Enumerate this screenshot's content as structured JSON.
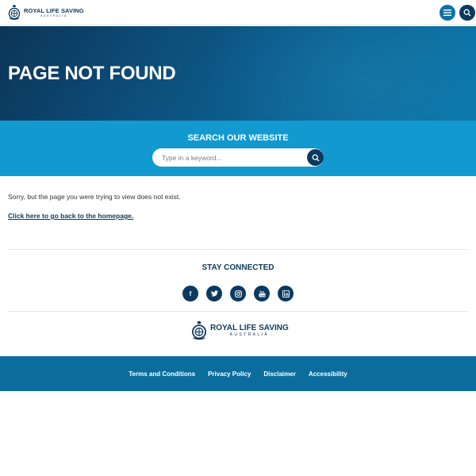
{
  "header": {
    "logo_main": "ROYAL LIFE SAVING",
    "logo_sub": "AUSTRALIA",
    "menu_icon": "hamburger-menu-icon",
    "search_icon": "search-icon"
  },
  "hero": {
    "title": "PAGE NOT FOUND"
  },
  "search": {
    "title": "SEARCH OUR WEBSITE",
    "placeholder": "Type in a keyword..."
  },
  "content": {
    "message": "Sorry, but the page you were trying to view does not exist.",
    "home_link": "Click here to go back to the homepage."
  },
  "social": {
    "title": "STAY CONNECTED",
    "items": [
      {
        "name": "facebook-icon",
        "glyph": "f"
      },
      {
        "name": "twitter-icon",
        "glyph": ""
      },
      {
        "name": "instagram-icon",
        "glyph": ""
      },
      {
        "name": "youtube-icon",
        "glyph": ""
      },
      {
        "name": "linkedin-icon",
        "glyph": ""
      }
    ]
  },
  "footer_logo": {
    "main": "ROYAL LIFE SAVING",
    "sub": "AUSTRALIA"
  },
  "footer": {
    "links": [
      "Terms and Conditions",
      "Privacy Policy",
      "Disclaimer",
      "Accessibility"
    ]
  },
  "colors": {
    "navy": "#0b3a5e",
    "search_band": "#1199d0",
    "footer": "#0b6d9e"
  }
}
